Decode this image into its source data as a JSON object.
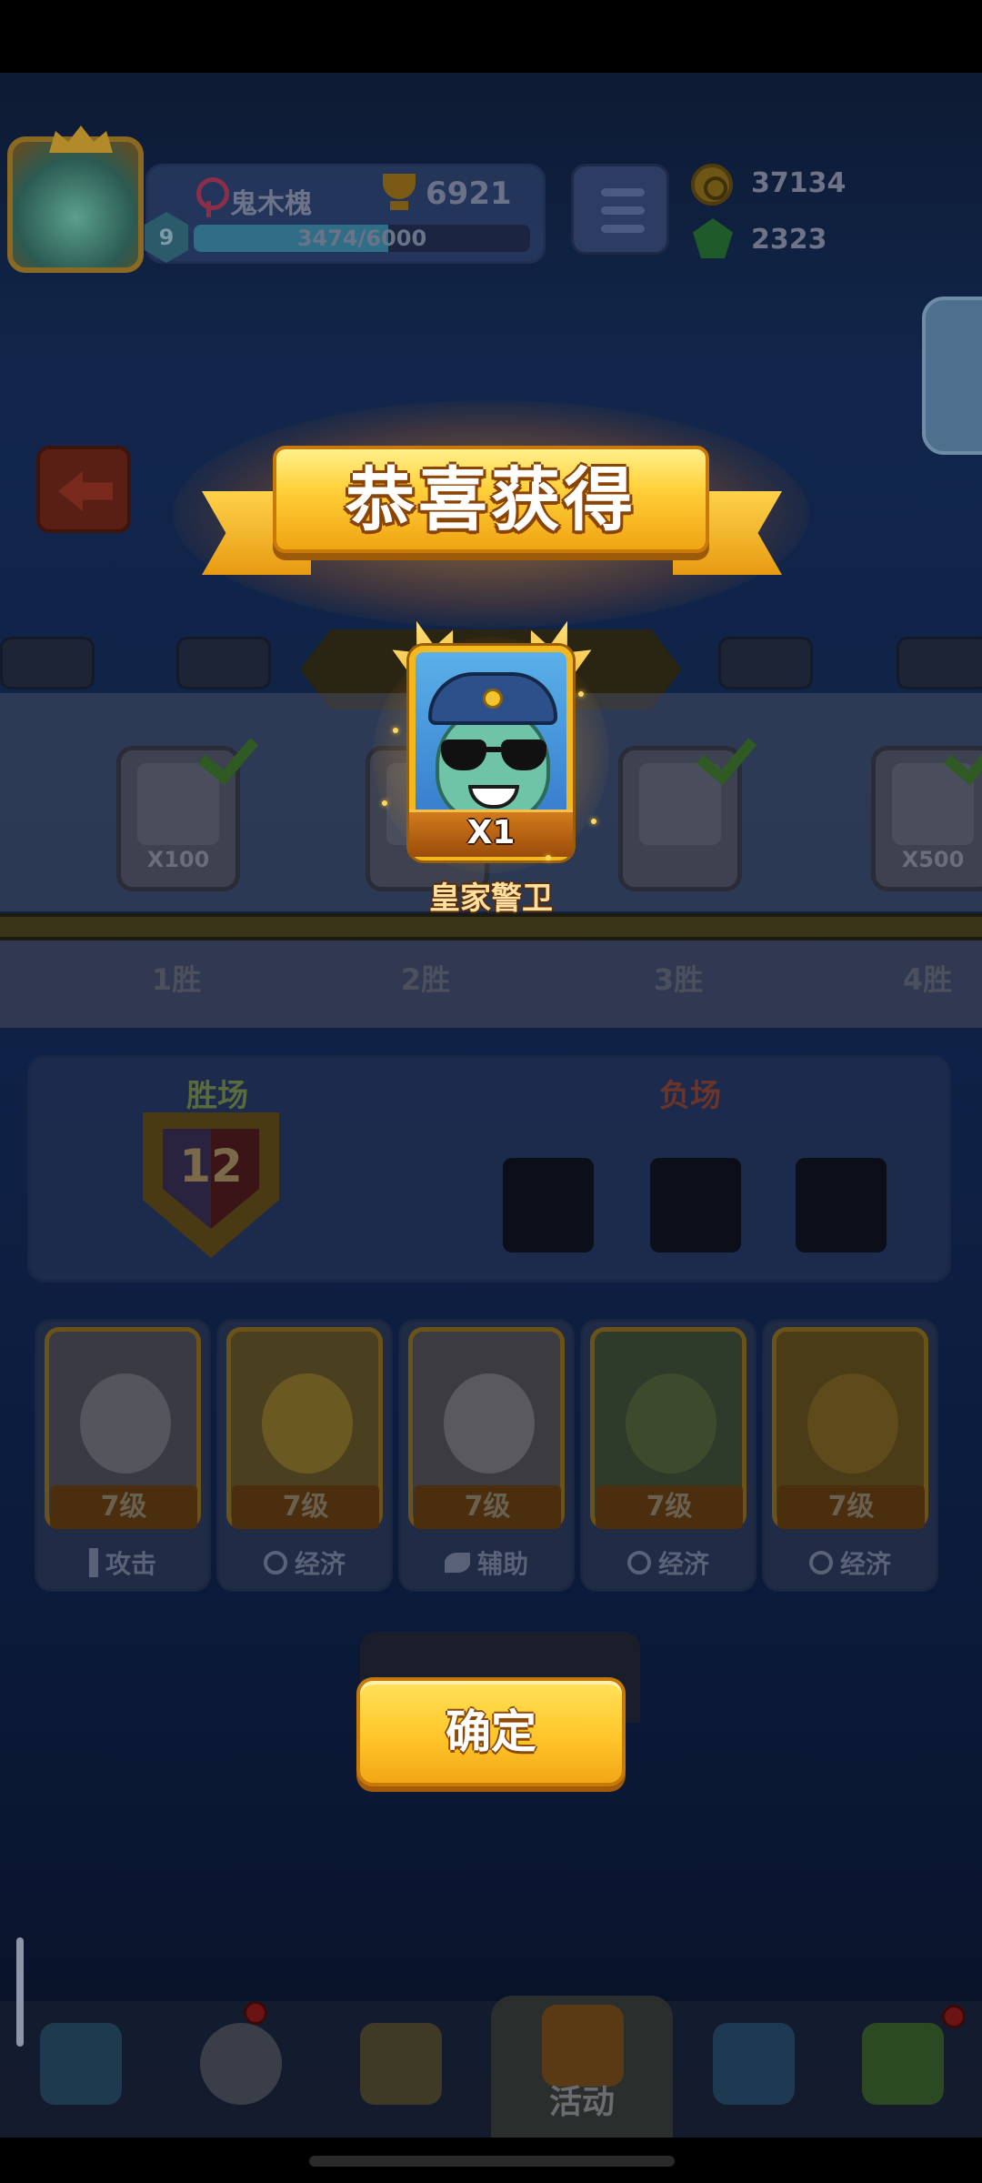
{
  "top_bar": {
    "player_name": "鬼木槐",
    "trophies": "6921",
    "level": "9",
    "xp_text": "3474/6000",
    "xp_progress": 0.579,
    "coins": "37134",
    "gems": "2323"
  },
  "track": {
    "rewards": [
      {
        "qty": "X100",
        "claimed": true
      },
      {
        "qty": "",
        "claimed": false
      },
      {
        "qty": "",
        "claimed": true
      },
      {
        "qty": "X500",
        "claimed": true
      }
    ],
    "win_labels": [
      "1胜",
      "2胜",
      "3胜",
      "4胜"
    ]
  },
  "record": {
    "wins_title": "胜场",
    "losses_title": "负场",
    "wins_count": "12"
  },
  "heroes": [
    {
      "level": "7级",
      "role": "攻击",
      "role_icon": "sword-icon"
    },
    {
      "level": "7级",
      "role": "经济",
      "role_icon": "coin-g-icon"
    },
    {
      "level": "7级",
      "role": "辅助",
      "role_icon": "leaf-icon"
    },
    {
      "level": "7级",
      "role": "经济",
      "role_icon": "coin-g-icon"
    },
    {
      "level": "7级",
      "role": "经济",
      "role_icon": "coin-g-icon"
    }
  ],
  "modal": {
    "title": "恭喜获得",
    "reward_qty": "X1",
    "reward_name": "皇家警卫",
    "confirm_label": "确定"
  },
  "bottom_nav": {
    "items": [
      {
        "icon": "chest-icon",
        "label": ""
      },
      {
        "icon": "helmet-icon",
        "label": ""
      },
      {
        "icon": "swords-icon",
        "label": ""
      },
      {
        "icon": "crown-shield-icon",
        "label": "活动",
        "active": true
      },
      {
        "icon": "team-icon",
        "label": ""
      },
      {
        "icon": "gift-icon",
        "label": ""
      }
    ]
  },
  "colors": {
    "accent_gold": "#ffc62a",
    "ribbon_outline": "#8a4406",
    "win_title": "#5a6a3a",
    "loss_title": "#6a3428"
  }
}
